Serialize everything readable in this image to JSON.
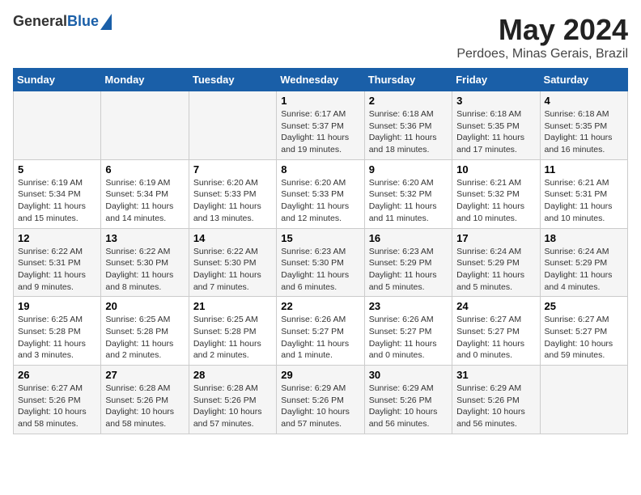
{
  "logo": {
    "general": "General",
    "blue": "Blue"
  },
  "title": "May 2024",
  "subtitle": "Perdoes, Minas Gerais, Brazil",
  "days_header": [
    "Sunday",
    "Monday",
    "Tuesday",
    "Wednesday",
    "Thursday",
    "Friday",
    "Saturday"
  ],
  "weeks": [
    [
      {
        "day": "",
        "info": ""
      },
      {
        "day": "",
        "info": ""
      },
      {
        "day": "",
        "info": ""
      },
      {
        "day": "1",
        "info": "Sunrise: 6:17 AM\nSunset: 5:37 PM\nDaylight: 11 hours\nand 19 minutes."
      },
      {
        "day": "2",
        "info": "Sunrise: 6:18 AM\nSunset: 5:36 PM\nDaylight: 11 hours\nand 18 minutes."
      },
      {
        "day": "3",
        "info": "Sunrise: 6:18 AM\nSunset: 5:35 PM\nDaylight: 11 hours\nand 17 minutes."
      },
      {
        "day": "4",
        "info": "Sunrise: 6:18 AM\nSunset: 5:35 PM\nDaylight: 11 hours\nand 16 minutes."
      }
    ],
    [
      {
        "day": "5",
        "info": "Sunrise: 6:19 AM\nSunset: 5:34 PM\nDaylight: 11 hours\nand 15 minutes."
      },
      {
        "day": "6",
        "info": "Sunrise: 6:19 AM\nSunset: 5:34 PM\nDaylight: 11 hours\nand 14 minutes."
      },
      {
        "day": "7",
        "info": "Sunrise: 6:20 AM\nSunset: 5:33 PM\nDaylight: 11 hours\nand 13 minutes."
      },
      {
        "day": "8",
        "info": "Sunrise: 6:20 AM\nSunset: 5:33 PM\nDaylight: 11 hours\nand 12 minutes."
      },
      {
        "day": "9",
        "info": "Sunrise: 6:20 AM\nSunset: 5:32 PM\nDaylight: 11 hours\nand 11 minutes."
      },
      {
        "day": "10",
        "info": "Sunrise: 6:21 AM\nSunset: 5:32 PM\nDaylight: 11 hours\nand 10 minutes."
      },
      {
        "day": "11",
        "info": "Sunrise: 6:21 AM\nSunset: 5:31 PM\nDaylight: 11 hours\nand 10 minutes."
      }
    ],
    [
      {
        "day": "12",
        "info": "Sunrise: 6:22 AM\nSunset: 5:31 PM\nDaylight: 11 hours\nand 9 minutes."
      },
      {
        "day": "13",
        "info": "Sunrise: 6:22 AM\nSunset: 5:30 PM\nDaylight: 11 hours\nand 8 minutes."
      },
      {
        "day": "14",
        "info": "Sunrise: 6:22 AM\nSunset: 5:30 PM\nDaylight: 11 hours\nand 7 minutes."
      },
      {
        "day": "15",
        "info": "Sunrise: 6:23 AM\nSunset: 5:30 PM\nDaylight: 11 hours\nand 6 minutes."
      },
      {
        "day": "16",
        "info": "Sunrise: 6:23 AM\nSunset: 5:29 PM\nDaylight: 11 hours\nand 5 minutes."
      },
      {
        "day": "17",
        "info": "Sunrise: 6:24 AM\nSunset: 5:29 PM\nDaylight: 11 hours\nand 5 minutes."
      },
      {
        "day": "18",
        "info": "Sunrise: 6:24 AM\nSunset: 5:29 PM\nDaylight: 11 hours\nand 4 minutes."
      }
    ],
    [
      {
        "day": "19",
        "info": "Sunrise: 6:25 AM\nSunset: 5:28 PM\nDaylight: 11 hours\nand 3 minutes."
      },
      {
        "day": "20",
        "info": "Sunrise: 6:25 AM\nSunset: 5:28 PM\nDaylight: 11 hours\nand 2 minutes."
      },
      {
        "day": "21",
        "info": "Sunrise: 6:25 AM\nSunset: 5:28 PM\nDaylight: 11 hours\nand 2 minutes."
      },
      {
        "day": "22",
        "info": "Sunrise: 6:26 AM\nSunset: 5:27 PM\nDaylight: 11 hours\nand 1 minute."
      },
      {
        "day": "23",
        "info": "Sunrise: 6:26 AM\nSunset: 5:27 PM\nDaylight: 11 hours\nand 0 minutes."
      },
      {
        "day": "24",
        "info": "Sunrise: 6:27 AM\nSunset: 5:27 PM\nDaylight: 11 hours\nand 0 minutes."
      },
      {
        "day": "25",
        "info": "Sunrise: 6:27 AM\nSunset: 5:27 PM\nDaylight: 10 hours\nand 59 minutes."
      }
    ],
    [
      {
        "day": "26",
        "info": "Sunrise: 6:27 AM\nSunset: 5:26 PM\nDaylight: 10 hours\nand 58 minutes."
      },
      {
        "day": "27",
        "info": "Sunrise: 6:28 AM\nSunset: 5:26 PM\nDaylight: 10 hours\nand 58 minutes."
      },
      {
        "day": "28",
        "info": "Sunrise: 6:28 AM\nSunset: 5:26 PM\nDaylight: 10 hours\nand 57 minutes."
      },
      {
        "day": "29",
        "info": "Sunrise: 6:29 AM\nSunset: 5:26 PM\nDaylight: 10 hours\nand 57 minutes."
      },
      {
        "day": "30",
        "info": "Sunrise: 6:29 AM\nSunset: 5:26 PM\nDaylight: 10 hours\nand 56 minutes."
      },
      {
        "day": "31",
        "info": "Sunrise: 6:29 AM\nSunset: 5:26 PM\nDaylight: 10 hours\nand 56 minutes."
      },
      {
        "day": "",
        "info": ""
      }
    ]
  ]
}
